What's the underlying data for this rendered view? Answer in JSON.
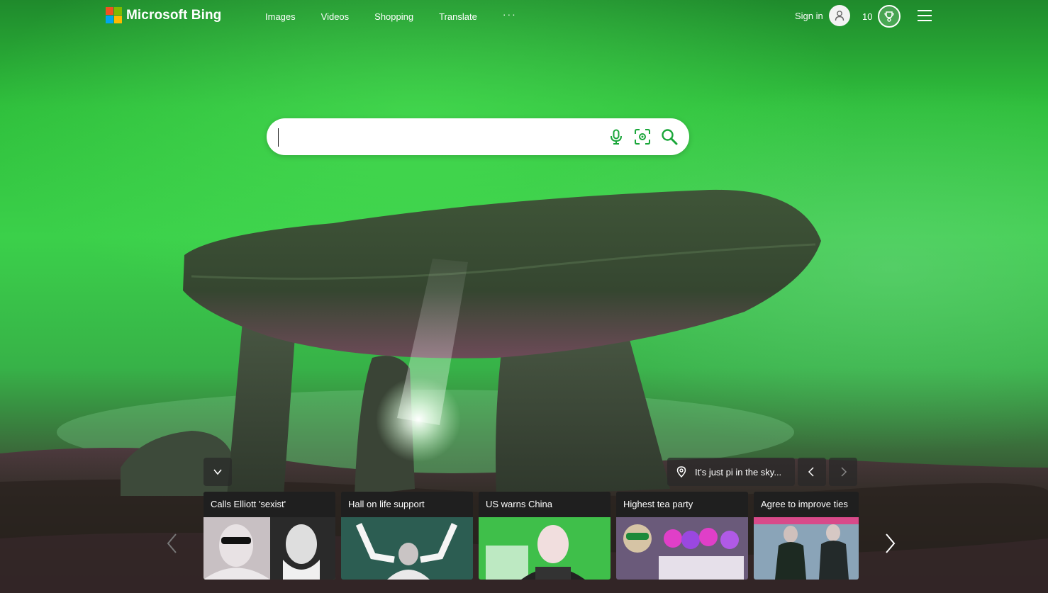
{
  "header": {
    "logo_text": "Microsoft Bing",
    "logo_colors": [
      "#f25022",
      "#7fba00",
      "#00a4ef",
      "#ffb900"
    ],
    "nav": [
      {
        "label": "Images"
      },
      {
        "label": "Videos"
      },
      {
        "label": "Shopping"
      },
      {
        "label": "Translate"
      },
      {
        "label": "···"
      }
    ],
    "sign_in_label": "Sign in",
    "rewards_points": "10",
    "icons": {
      "avatar": "person-icon",
      "rewards": "trophy-icon",
      "menu": "hamburger-menu-icon"
    }
  },
  "search": {
    "value": "",
    "placeholder": "",
    "icons": [
      "microphone-icon",
      "visual-search-icon",
      "search-icon"
    ],
    "accent": "#1aa63a"
  },
  "image_info": {
    "caption": "It's just pi in the sky..."
  },
  "news": {
    "cards": [
      {
        "title": "Calls Elliott 'sexist'"
      },
      {
        "title": "Hall on life support"
      },
      {
        "title": "US warns China"
      },
      {
        "title": "Highest tea party"
      },
      {
        "title": "Agree to improve ties"
      }
    ]
  }
}
